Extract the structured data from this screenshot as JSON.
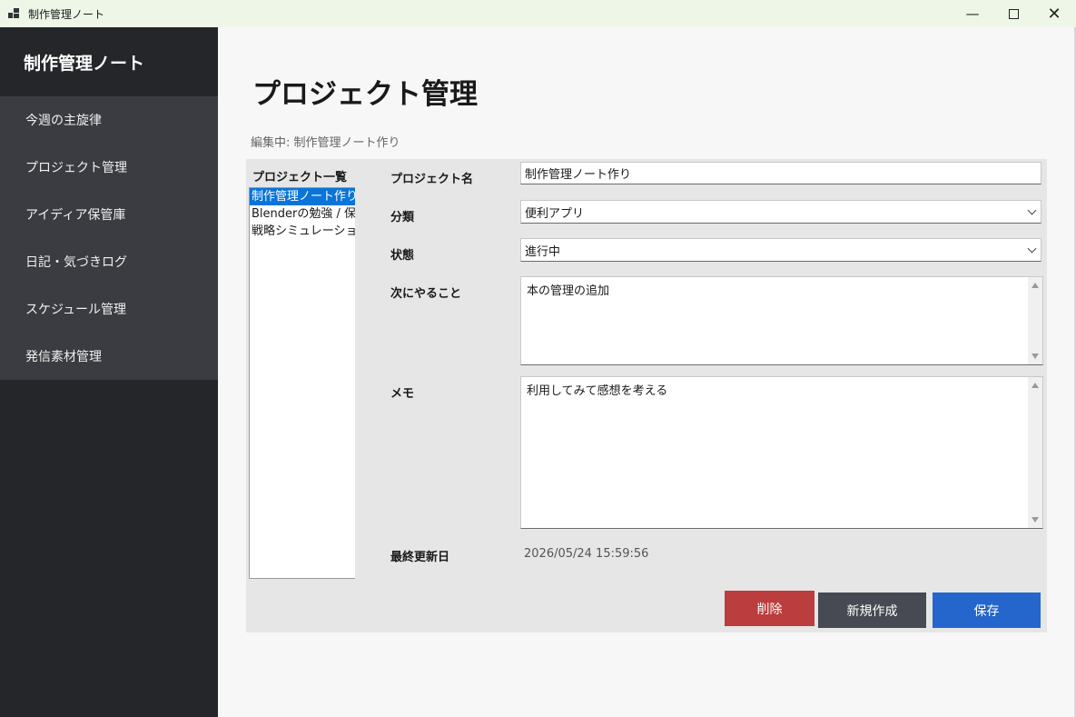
{
  "window": {
    "title": "制作管理ノート"
  },
  "sidebar": {
    "brand": "制作管理ノート",
    "items": [
      {
        "label": "今週の主旋律"
      },
      {
        "label": "プロジェクト管理"
      },
      {
        "label": "アイディア保管庫"
      },
      {
        "label": "日記・気づきログ"
      },
      {
        "label": "スケジュール管理"
      },
      {
        "label": "発信素材管理"
      }
    ]
  },
  "page": {
    "title": "プロジェクト管理",
    "editing": "編集中: 制作管理ノート作り"
  },
  "project_list": {
    "label": "プロジェクト一覧",
    "items": [
      {
        "text": "制作管理ノート作り /",
        "selected": true
      },
      {
        "text": "Blenderの勉強 / 保留",
        "selected": false
      },
      {
        "text": "戦略シミュレーション /",
        "selected": false
      }
    ]
  },
  "form": {
    "name_label": "プロジェクト名",
    "name_value": "制作管理ノート作り",
    "category_label": "分類",
    "category_value": "便利アプリ",
    "status_label": "状態",
    "status_value": "進行中",
    "next_label": "次にやること",
    "next_value": "本の管理の追加",
    "memo_label": "メモ",
    "memo_value": "利用してみて感想を考える",
    "updated_label": "最終更新日",
    "updated_value": "2026/05/24 15:59:56"
  },
  "buttons": {
    "delete": "削除",
    "new": "新規作成",
    "save": "保存"
  },
  "colors": {
    "sidebar_bg": "#25262a",
    "menu_bg": "#3a3c41",
    "delete": "#bb3d3d",
    "new": "#474a52",
    "save": "#2466cc",
    "selection": "#0a74d9"
  }
}
